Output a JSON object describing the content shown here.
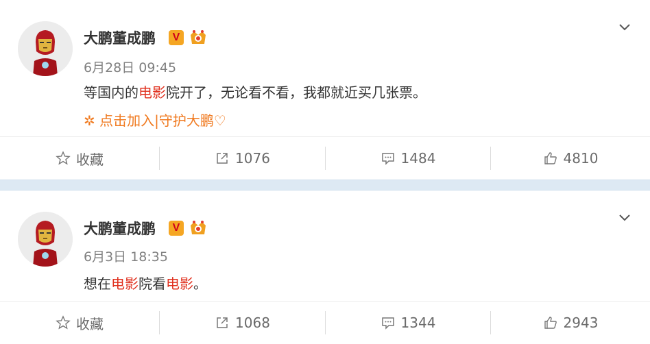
{
  "posts": [
    {
      "author": "大鹏董成鹏",
      "verified_badge": "V",
      "time": "6月28日 09:45",
      "text_segments": [
        "等国内的",
        "电影",
        "院开了，无论看不看，我都就近买几张票。"
      ],
      "promo": "点击加入|守护大鹏♡",
      "promo_icon": "✲",
      "actions": {
        "favorite": "收藏",
        "repost": "1076",
        "comment": "1484",
        "like": "4810"
      }
    },
    {
      "author": "大鹏董成鹏",
      "verified_badge": "V",
      "time": "6月3日 18:35",
      "text_segments": [
        "想在",
        "电影",
        "院看",
        "电影",
        "。"
      ],
      "actions": {
        "favorite": "收藏",
        "repost": "1068",
        "comment": "1344",
        "like": "2943"
      }
    }
  ],
  "colors": {
    "highlight": "#e0301e",
    "promo": "#f07a20",
    "badge_bg": "#f5a623",
    "separator": "#dde9f3"
  },
  "icons": {
    "favorite": "star-icon",
    "repost": "share-icon",
    "comment": "comment-icon",
    "like": "thumbs-up-icon",
    "menu": "chevron-down-icon"
  }
}
